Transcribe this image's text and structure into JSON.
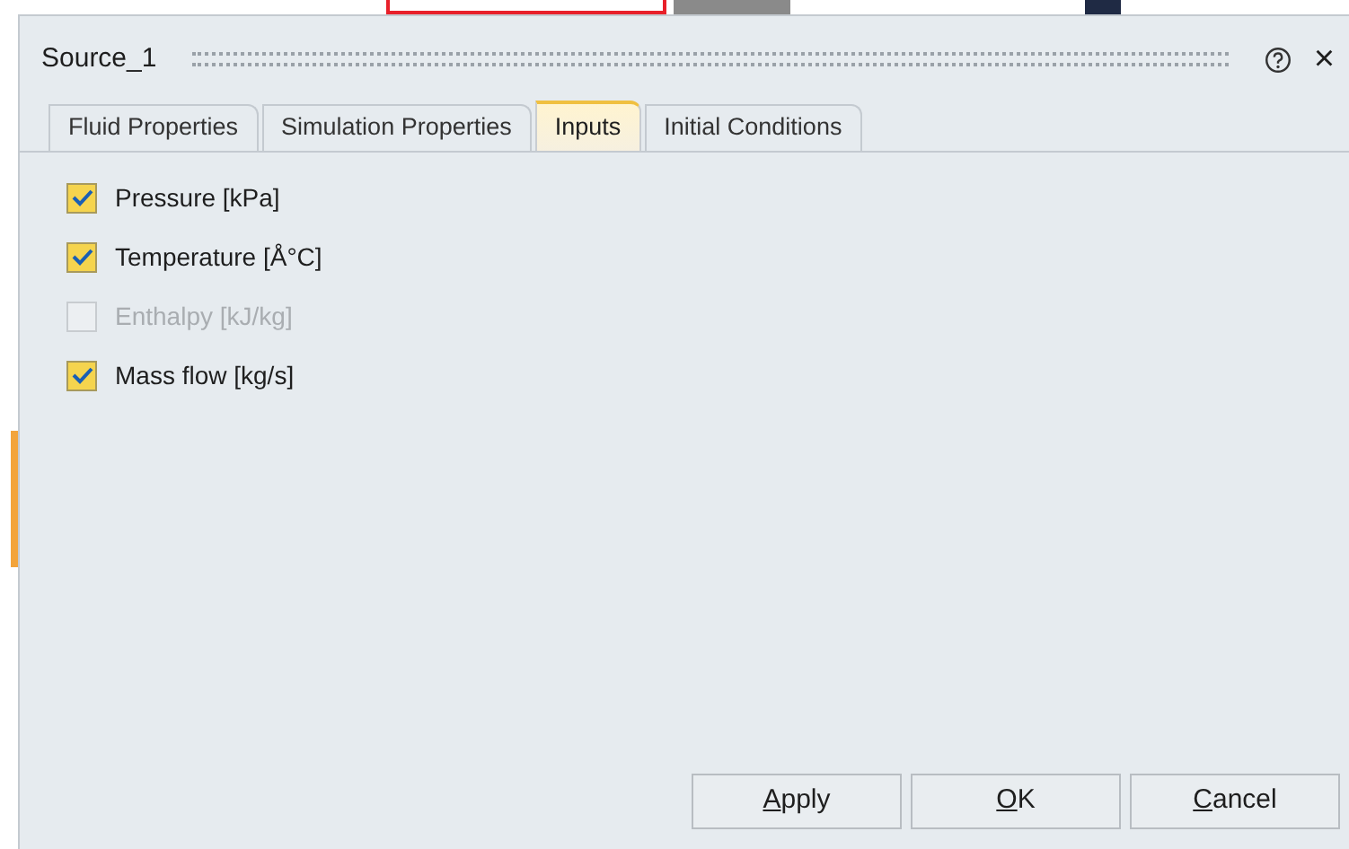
{
  "window": {
    "title": "Source_1",
    "close_icon": "×"
  },
  "tabs": [
    {
      "label": "Fluid Properties",
      "selected": false
    },
    {
      "label": "Simulation Properties",
      "selected": false
    },
    {
      "label": "Inputs",
      "selected": true
    },
    {
      "label": "Initial Conditions",
      "selected": false
    }
  ],
  "inputs": [
    {
      "label": "Pressure [kPa]",
      "checked": true,
      "disabled": false
    },
    {
      "label": "Temperature [Å°C]",
      "checked": true,
      "disabled": false
    },
    {
      "label": "Enthalpy [kJ/kg]",
      "checked": false,
      "disabled": true
    },
    {
      "label": "Mass flow [kg/s]",
      "checked": true,
      "disabled": false
    }
  ],
  "buttons": [
    {
      "label": "Apply",
      "mnemonic": true
    },
    {
      "label": "OK",
      "mnemonic": true
    },
    {
      "label": "Cancel",
      "mnemonic": true
    }
  ]
}
